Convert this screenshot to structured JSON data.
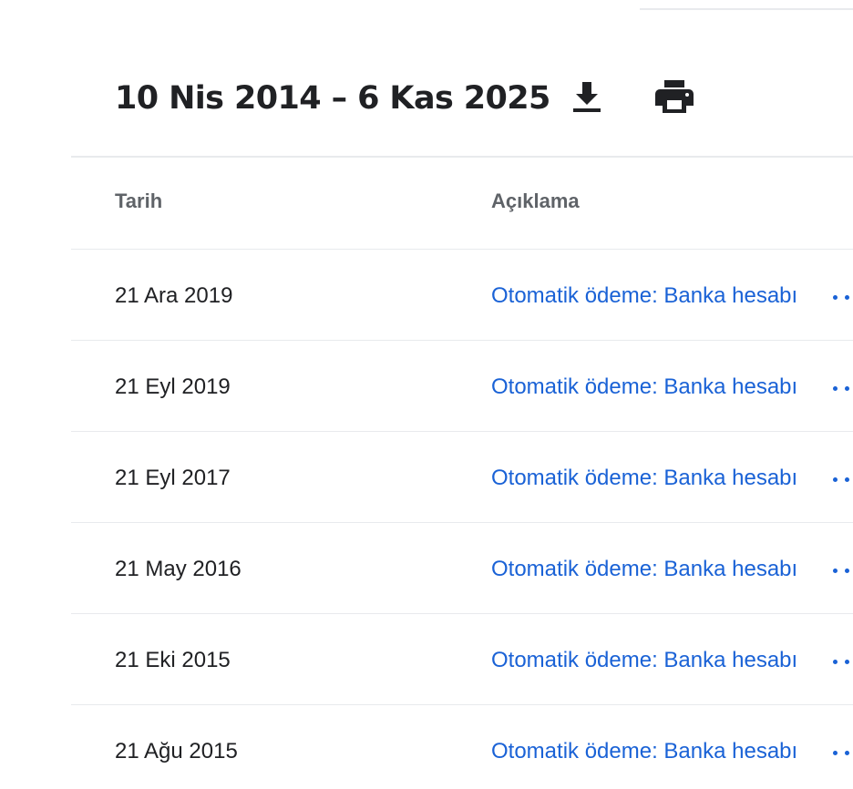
{
  "header": {
    "date_range": "10 Nis 2014 – 6 Kas 2025",
    "download_icon": "download-icon",
    "print_icon": "print-icon"
  },
  "table": {
    "columns": [
      "Tarih",
      "Açıklama"
    ],
    "rows": [
      {
        "date": "21 Ara 2019",
        "description": "Otomatik ödeme: Banka hesabı"
      },
      {
        "date": "21 Eyl 2019",
        "description": "Otomatik ödeme: Banka hesabı"
      },
      {
        "date": "21 Eyl 2017",
        "description": "Otomatik ödeme: Banka hesabı"
      },
      {
        "date": "21 May 2016",
        "description": "Otomatik ödeme: Banka hesabı"
      },
      {
        "date": "21 Eki 2015",
        "description": "Otomatik ödeme: Banka hesabı"
      },
      {
        "date": "21 Ağu 2015",
        "description": "Otomatik ödeme: Banka hesabı"
      }
    ]
  },
  "colors": {
    "link": "#1a62d6",
    "text": "#202124",
    "muted": "#5f6368",
    "divider": "#e8eaed"
  }
}
